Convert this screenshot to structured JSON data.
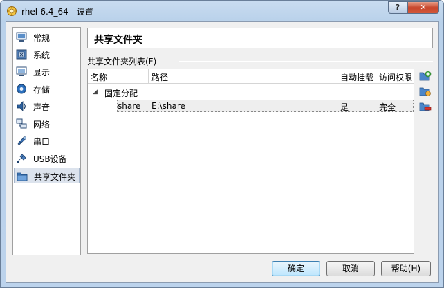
{
  "window": {
    "title": "rhel-6.4_64 - 设置",
    "help_label": "?",
    "close_label": "✕"
  },
  "sidebar": {
    "items": [
      {
        "label": "常规",
        "icon": "general-icon"
      },
      {
        "label": "系统",
        "icon": "system-icon"
      },
      {
        "label": "显示",
        "icon": "display-icon"
      },
      {
        "label": "存储",
        "icon": "storage-icon"
      },
      {
        "label": "声音",
        "icon": "audio-icon"
      },
      {
        "label": "网络",
        "icon": "network-icon"
      },
      {
        "label": "串口",
        "icon": "serial-port-icon"
      },
      {
        "label": "USB设备",
        "icon": "usb-icon"
      },
      {
        "label": "共享文件夹",
        "icon": "shared-folder-icon"
      }
    ],
    "selected_index": 8
  },
  "main": {
    "page_title": "共享文件夹",
    "group_label": "共享文件夹列表(F)",
    "columns": [
      "名称",
      "路径",
      "自动挂载",
      "访问权限"
    ],
    "group_name": "固定分配",
    "tree_arrow": "◢",
    "rows": [
      {
        "name": "share",
        "path": "E:\\share",
        "automount": "是",
        "access": "完全"
      }
    ]
  },
  "footer": {
    "ok_label": "确定",
    "cancel_label": "取消",
    "help_label": "帮助(H)"
  },
  "colors": {
    "accent": "#3c7fb1",
    "selection": "#dce3ed",
    "close_red": "#c7452b"
  }
}
